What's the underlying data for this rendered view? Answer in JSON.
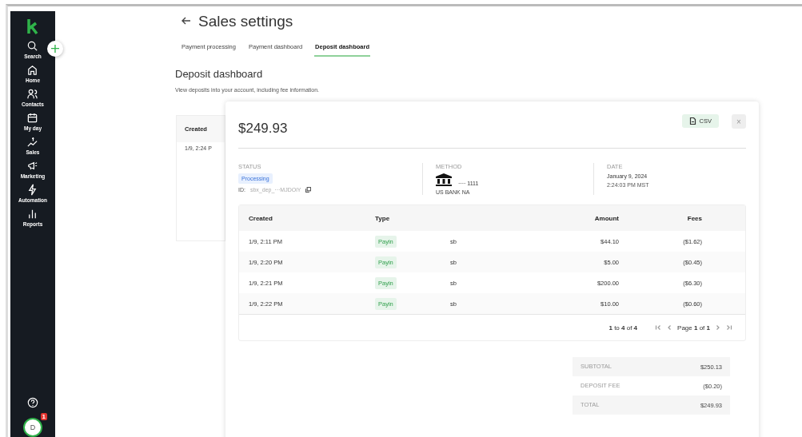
{
  "sidebar": {
    "add_button": "+",
    "items": [
      {
        "label": "Search"
      },
      {
        "label": "Home"
      },
      {
        "label": "Contacts"
      },
      {
        "label": "My day"
      },
      {
        "label": "Sales"
      },
      {
        "label": "Marketing"
      },
      {
        "label": "Automation"
      },
      {
        "label": "Reports"
      }
    ],
    "avatar": {
      "initial": "D",
      "badge": "1"
    }
  },
  "page": {
    "title": "Sales settings",
    "tabs": [
      {
        "label": "Payment processing",
        "selected": false
      },
      {
        "label": "Payment dashboard",
        "selected": false
      },
      {
        "label": "Deposit dashboard",
        "selected": true
      }
    ],
    "section_title": "Deposit dashboard",
    "description": "View deposits into your account, including fee information.",
    "background_table": {
      "columns": [
        "Created"
      ],
      "rows": [
        [
          "1/9, 2:24 P"
        ]
      ]
    }
  },
  "modal": {
    "amount": "$249.93",
    "csv_button": "CSV",
    "close_button": "×",
    "status": {
      "label": "STATUS",
      "badge": "Processing",
      "id_label": "ID:",
      "id_value": "sbx_dep_···MJDOiY"
    },
    "method": {
      "label": "METHOD",
      "account": "···· 1111",
      "bank": "US BANK NA"
    },
    "date": {
      "label": "DATE",
      "date": "January 9, 2024",
      "time": "2:24:03 PM MST"
    },
    "table": {
      "columns": [
        "Created",
        "Type",
        "Amount",
        "Fees"
      ],
      "rows": [
        {
          "created": "1/9, 2:11 PM",
          "type": "Payin",
          "column_3": "sb",
          "amount": "$44.10",
          "fees": "($1.62)"
        },
        {
          "created": "1/9, 2:20 PM",
          "type": "Payin",
          "column_3": "sb",
          "amount": "$5.00",
          "fees": "($0.45)"
        },
        {
          "created": "1/9, 2:21 PM",
          "type": "Payin",
          "column_3": "sb",
          "amount": "$200.00",
          "fees": "($6.30)"
        },
        {
          "created": "1/9, 2:22 PM",
          "type": "Payin",
          "column_3": "sb",
          "amount": "$10.00",
          "fees": "($0.60)"
        }
      ],
      "pagination": {
        "range": "**1** to **4** of **4**",
        "page": "Page **1** of **1**"
      }
    },
    "totals": [
      {
        "label": "SUBTOTAL",
        "value": "$250.13"
      },
      {
        "label": "DEPOSIT FEE",
        "value": "($0.20)"
      },
      {
        "label": "TOTAL",
        "value": "$249.93"
      }
    ]
  }
}
